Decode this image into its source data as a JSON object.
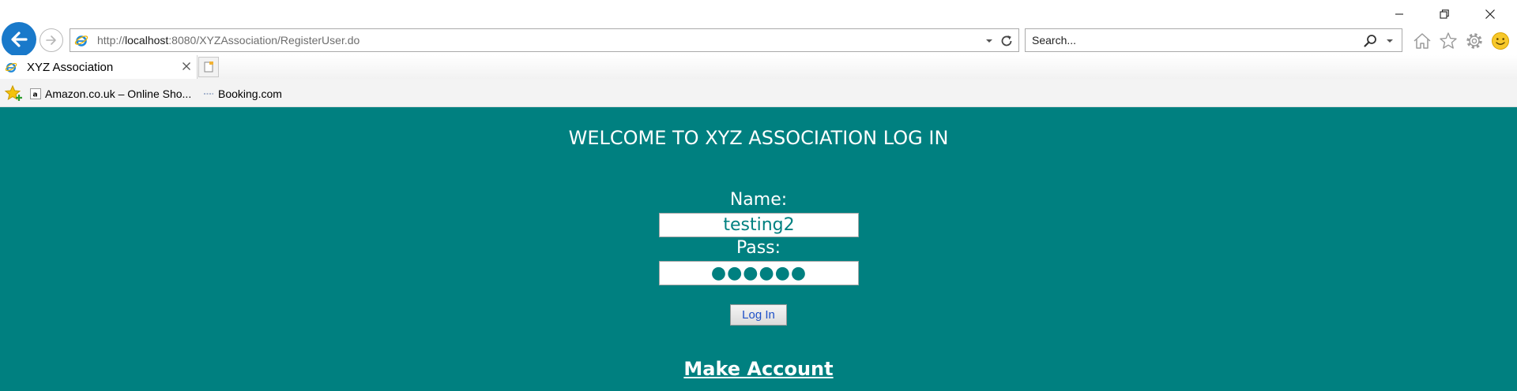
{
  "browser": {
    "address_url_prefix": "http://",
    "address_url_host": "localhost",
    "address_url_rest": ":8080/XYZAssociation/RegisterUser.do",
    "search_placeholder": "Search...",
    "tab_title": "XYZ Association",
    "favorites": [
      {
        "label": "Amazon.co.uk – Online Sho...",
        "icon": "amazon-icon"
      },
      {
        "label": "Booking.com",
        "icon": "booking-icon"
      }
    ],
    "colors": {
      "back_button": "#1979ca",
      "favorites_bar": "#f3f3f3"
    }
  },
  "page": {
    "welcome_heading": "WELCOME TO XYZ ASSOCIATION LOG IN",
    "name_label": "Name:",
    "name_value": "testing2",
    "pass_label": "Pass:",
    "pass_value": "●●●●●●",
    "login_button_label": "Log In",
    "make_account_link": "Make Account",
    "colors": {
      "background": "#008080",
      "text": "#ffffff",
      "input_text": "#008080",
      "button_text": "#1e50c8"
    }
  }
}
